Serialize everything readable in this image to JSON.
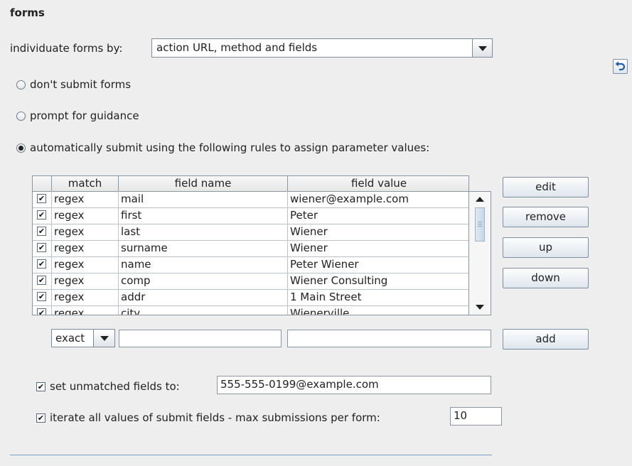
{
  "section_title": "forms",
  "individuate": {
    "label": "individuate forms by:",
    "selected": "action URL, method and fields"
  },
  "radios": [
    {
      "label": "don't submit forms",
      "selected": false
    },
    {
      "label": "prompt for guidance",
      "selected": false
    },
    {
      "label": "automatically submit using the following rules to assign parameter values:",
      "selected": true
    }
  ],
  "table": {
    "columns": [
      "",
      "match",
      "field name",
      "field value"
    ],
    "rows": [
      {
        "checked": "✔",
        "match": "regex",
        "field": "mail",
        "value": "wiener@example.com"
      },
      {
        "checked": "✔",
        "match": "regex",
        "field": "first",
        "value": "Peter"
      },
      {
        "checked": "✔",
        "match": "regex",
        "field": "last",
        "value": "Wiener"
      },
      {
        "checked": "✔",
        "match": "regex",
        "field": "surname",
        "value": "Wiener"
      },
      {
        "checked": "✔",
        "match": "regex",
        "field": "name",
        "value": "Peter Wiener"
      },
      {
        "checked": "✔",
        "match": "regex",
        "field": "comp",
        "value": "Wiener Consulting"
      },
      {
        "checked": "✔",
        "match": "regex",
        "field": "addr",
        "value": "1 Main Street"
      },
      {
        "checked": "✔",
        "match": "regex",
        "field": "city",
        "value": "Wienerville"
      }
    ]
  },
  "buttons": {
    "edit": "edit",
    "remove": "remove",
    "up": "up",
    "down": "down",
    "add": "add"
  },
  "new_rule": {
    "match_selected": "exact",
    "field_name": "",
    "field_value": ""
  },
  "unmatched": {
    "checked": "✔",
    "label": "set unmatched fields to:",
    "value": "555-555-0199@example.com"
  },
  "iterate": {
    "checked": "✔",
    "label": "iterate all values of submit fields - max submissions per form:",
    "value": "10"
  },
  "icons": {
    "undo": "undo-icon",
    "dropdown": "chevron-down-icon"
  }
}
